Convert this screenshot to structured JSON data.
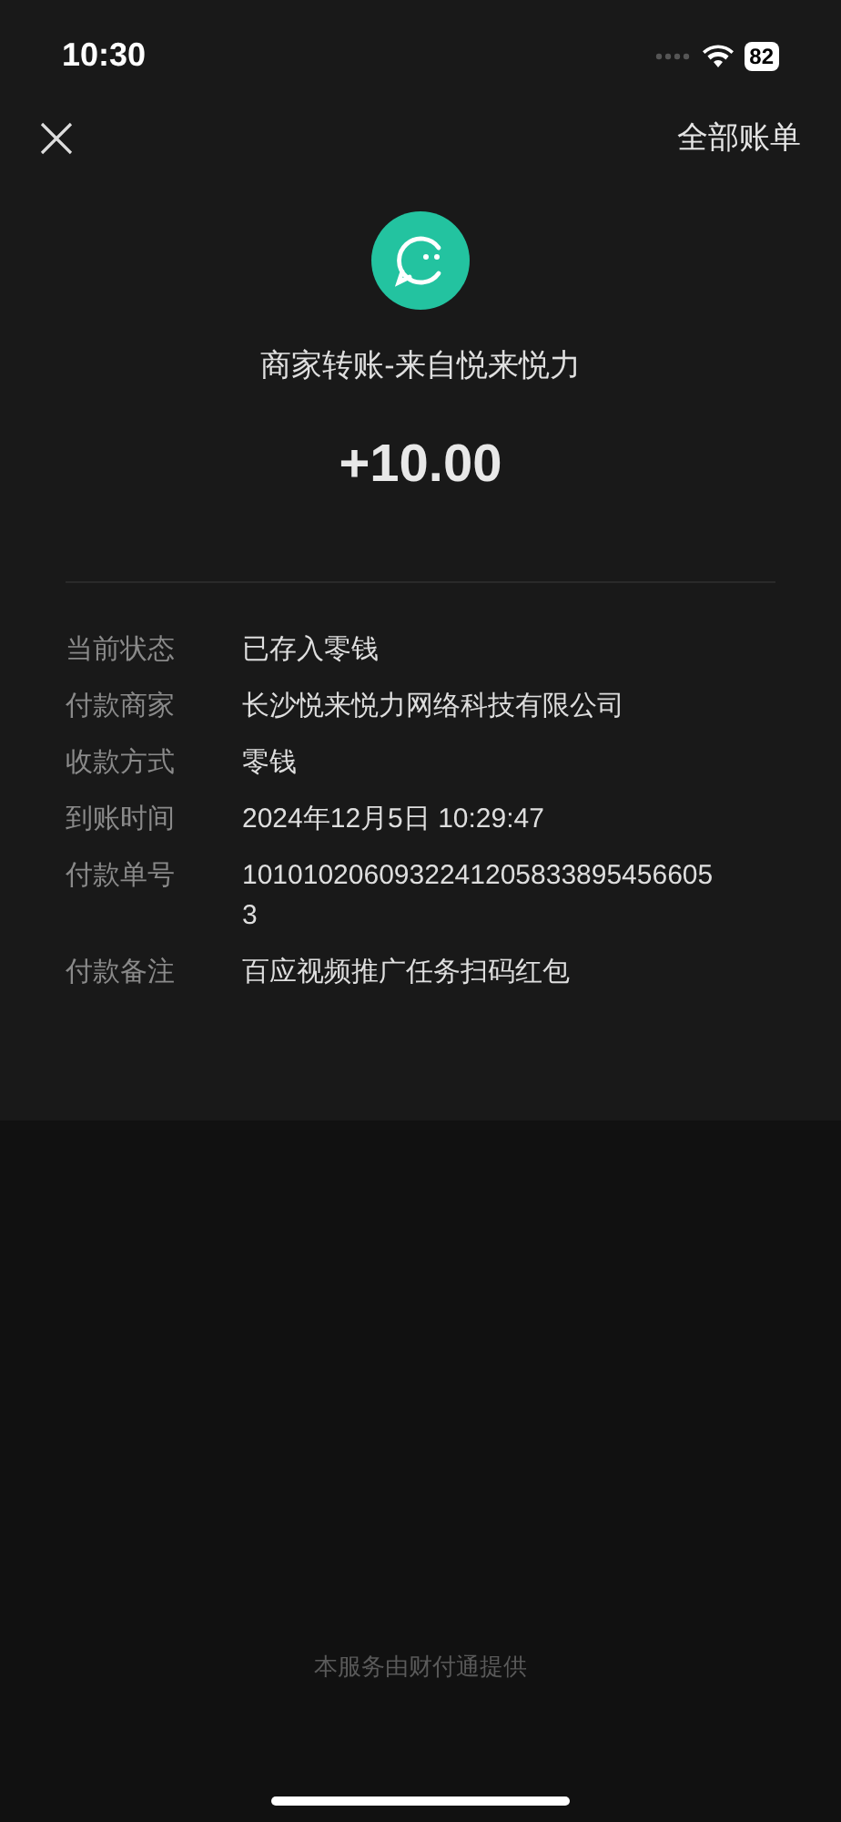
{
  "status_bar": {
    "time": "10:30",
    "battery": "82"
  },
  "nav": {
    "right_link": "全部账单"
  },
  "title": "商家转账-来自悦来悦力",
  "amount": "+10.00",
  "details": [
    {
      "label": "当前状态",
      "value": "已存入零钱"
    },
    {
      "label": "付款商家",
      "value": "长沙悦来悦力网络科技有限公司"
    },
    {
      "label": "收款方式",
      "value": "零钱"
    },
    {
      "label": "到账时间",
      "value": "2024年12月5日 10:29:47"
    },
    {
      "label": "付款单号",
      "value": "10101020609322412058338954566053"
    },
    {
      "label": "付款备注",
      "value": "百应视频推广任务扫码红包"
    }
  ],
  "footer": "本服务由财付通提供"
}
